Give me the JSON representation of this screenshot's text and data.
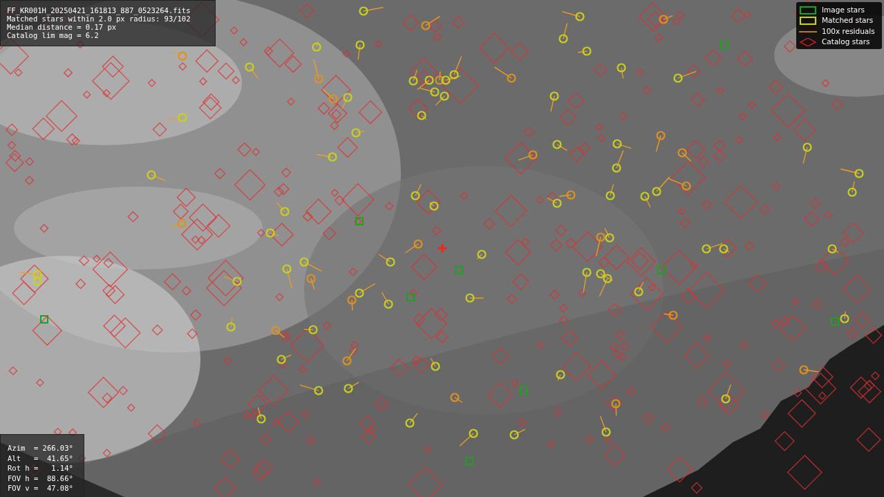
{
  "info_panel": {
    "lines": [
      "FF_KR001H_20250421_161813_887_0523264.fits",
      "Matched stars within 2.0 px radius: 93/102",
      "Median distance = 0.17 px",
      "Catalog lim mag = 6.2"
    ]
  },
  "pointing_panel": {
    "lines": [
      "Azim  = 266.03°",
      "Alt   =  41.65°",
      "Rot h =   1.14°",
      "FOV h =  88.66°",
      "FOV v =  47.08°"
    ]
  },
  "legend": {
    "items": [
      {
        "label": "Image stars"
      },
      {
        "kind": "matched",
        "label": "Matched stars"
      },
      {
        "kind": "residual",
        "label": "100x residuals"
      },
      {
        "kind": "catalog",
        "label": "Catalog stars"
      }
    ]
  }
}
